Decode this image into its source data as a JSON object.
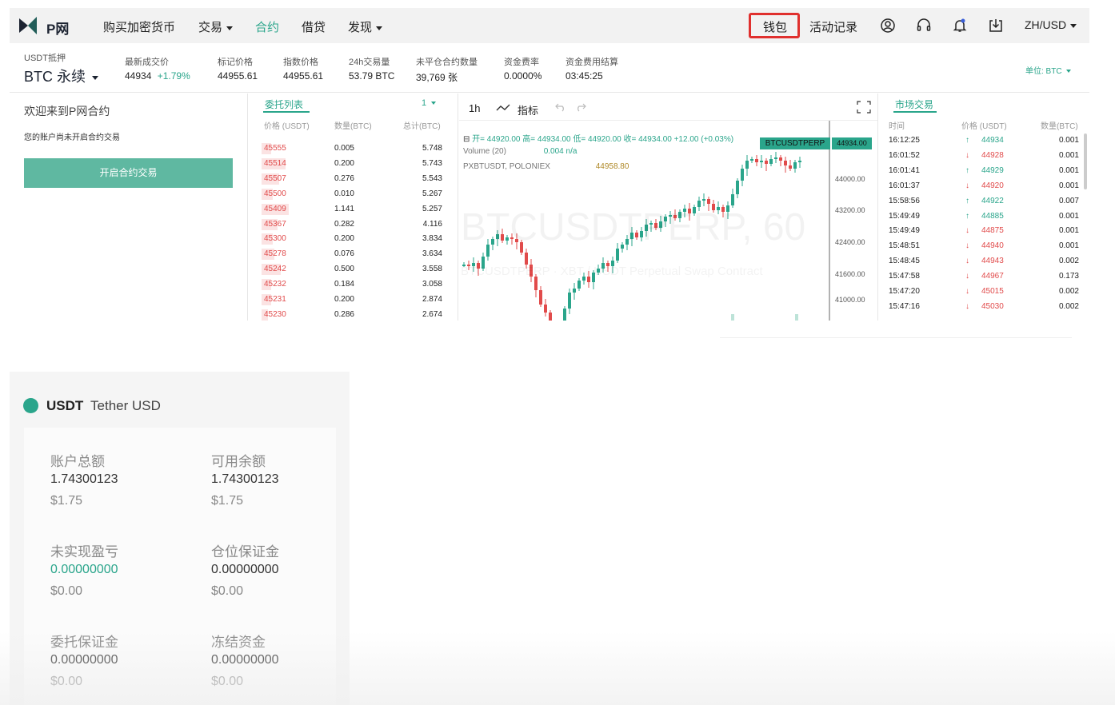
{
  "nav": {
    "logo_text": "P网",
    "items": [
      "购买加密货币",
      "交易",
      "合约",
      "借贷",
      "发现"
    ],
    "wallet": "钱包",
    "activity": "活动记录",
    "locale": "ZH/USD"
  },
  "info": {
    "collateral_label": "USDT抵押",
    "contract": "BTC 永续",
    "last_price_label": "最新成交价",
    "last_price": "44934",
    "change": "+1.79%",
    "mark_label": "标记价格",
    "mark": "44955.61",
    "index_label": "指数价格",
    "index": "44955.61",
    "volume_label": "24h交易量",
    "volume": "53.79 BTC",
    "oi_label": "未平仓合约数量",
    "oi": "39,769 张",
    "funding_label": "资金费率",
    "funding": "0.0000%",
    "settle_label": "资金费用结算",
    "settle": "03:45:25",
    "unit": "单位: BTC"
  },
  "welcome": {
    "title": "欢迎来到P网合约",
    "subtitle": "您的账户尚未开启合约交易",
    "button": "开启合约交易"
  },
  "orderbook": {
    "tab": "委托列表",
    "depth": "1",
    "headers": [
      "价格 (USDT)",
      "数量(BTC)",
      "总计(BTC)"
    ],
    "rows": [
      [
        "45555",
        "0.005",
        "5.748"
      ],
      [
        "45514",
        "0.200",
        "5.743"
      ],
      [
        "45507",
        "0.276",
        "5.543"
      ],
      [
        "45500",
        "0.010",
        "5.267"
      ],
      [
        "45409",
        "1.141",
        "5.257"
      ],
      [
        "45367",
        "0.282",
        "4.116"
      ],
      [
        "45300",
        "0.200",
        "3.834"
      ],
      [
        "45278",
        "0.076",
        "3.634"
      ],
      [
        "45242",
        "0.500",
        "3.558"
      ],
      [
        "45232",
        "0.184",
        "3.058"
      ],
      [
        "45231",
        "0.200",
        "2.874"
      ],
      [
        "45230",
        "0.286",
        "2.674"
      ]
    ]
  },
  "chart": {
    "interval": "1h",
    "indicator": "指标",
    "ohlc": "开= 44920.00  高= 44934.00  低= 44920.00  收= 44934.00  +12.00 (+0.03%)",
    "volume_label": "Volume (20)",
    "volume_vals": "0.004  n/a",
    "compare_label": "PXBTUSDT, POLONIEX",
    "compare_val": "44958.80",
    "watermark": "BTCUSDTPERP, 60",
    "watermark_sub": "BTCUSDTPERP · XBT / USDT Perpetual Swap Contract",
    "symbol_tag": "BTCUSDTPERP",
    "price_tag": "44934.00",
    "y_ticks": [
      "44000.00",
      "43200.00",
      "42400.00",
      "41600.00",
      "41000.00"
    ]
  },
  "trades": {
    "tab": "市场交易",
    "headers": [
      "时间",
      "价格 (USDT)",
      "数量(BTC)"
    ],
    "rows": [
      [
        "16:12:25",
        "up",
        "44934",
        "0.001"
      ],
      [
        "16:01:52",
        "down",
        "44928",
        "0.001"
      ],
      [
        "16:01:41",
        "up",
        "44929",
        "0.001"
      ],
      [
        "16:01:37",
        "down",
        "44920",
        "0.001"
      ],
      [
        "15:58:56",
        "up",
        "44922",
        "0.007"
      ],
      [
        "15:49:49",
        "up",
        "44885",
        "0.001"
      ],
      [
        "15:49:49",
        "down",
        "44875",
        "0.001"
      ],
      [
        "15:48:51",
        "down",
        "44940",
        "0.001"
      ],
      [
        "15:48:45",
        "down",
        "44943",
        "0.002"
      ],
      [
        "15:47:58",
        "down",
        "44967",
        "0.173"
      ],
      [
        "15:47:20",
        "down",
        "45015",
        "0.002"
      ],
      [
        "15:47:16",
        "down",
        "45030",
        "0.002"
      ]
    ]
  },
  "asset": {
    "symbol": "USDT",
    "name": "Tether USD",
    "total_label": "账户总额",
    "total": "1.74300123",
    "total_usd": "$1.75",
    "avail_label": "可用余额",
    "avail": "1.74300123",
    "avail_usd": "$1.75",
    "upnl_label": "未实现盈亏",
    "upnl": "0.00000000",
    "upnl_usd": "$0.00",
    "pos_margin_label": "仓位保证金",
    "pos_margin": "0.00000000",
    "pos_margin_usd": "$0.00",
    "order_margin_label": "委托保证金",
    "order_margin": "0.00000000",
    "order_margin_usd": "$0.00",
    "frozen_label": "冻结资金",
    "frozen": "0.00000000",
    "frozen_usd": "$0.00"
  },
  "colors": {
    "green": "#2aa58b",
    "red": "#e14b4b",
    "highlight": "#e0302e"
  }
}
